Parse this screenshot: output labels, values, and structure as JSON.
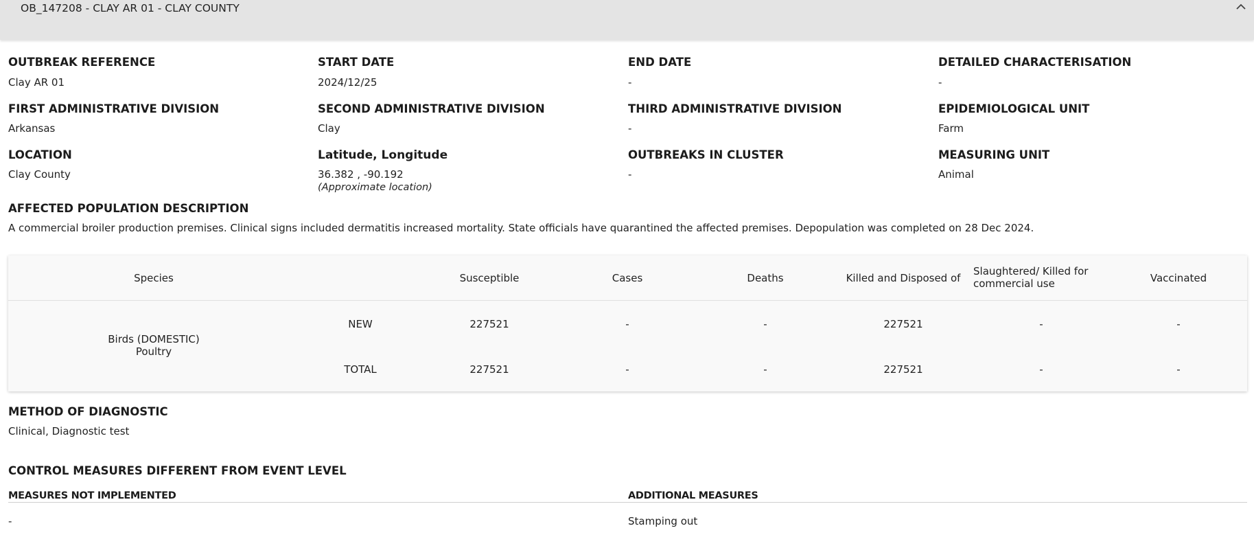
{
  "header": {
    "title": "OB_147208 - CLAY AR 01 - CLAY COUNTY"
  },
  "fields": {
    "outbreak_reference": {
      "label": "OUTBREAK REFERENCE",
      "value": "Clay AR 01"
    },
    "start_date": {
      "label": "START DATE",
      "value": "2024/12/25"
    },
    "end_date": {
      "label": "END DATE",
      "value": "-"
    },
    "detailed_characterisation": {
      "label": "DETAILED CHARACTERISATION",
      "value": "-"
    },
    "first_admin_division": {
      "label": "FIRST ADMINISTRATIVE DIVISION",
      "value": "Arkansas"
    },
    "second_admin_division": {
      "label": "SECOND ADMINISTRATIVE DIVISION",
      "value": "Clay"
    },
    "third_admin_division": {
      "label": "THIRD ADMINISTRATIVE DIVISION",
      "value": "-"
    },
    "epidemiological_unit": {
      "label": "EPIDEMIOLOGICAL UNIT",
      "value": "Farm"
    },
    "location": {
      "label": "LOCATION",
      "value": "Clay County"
    },
    "lat_long": {
      "label": "Latitude, Longitude",
      "value": "36.382 , -90.192",
      "note": "(Approximate location)"
    },
    "outbreaks_in_cluster": {
      "label": "OUTBREAKS IN CLUSTER",
      "value": "-"
    },
    "measuring_unit": {
      "label": "MEASURING UNIT",
      "value": "Animal"
    }
  },
  "affected_population": {
    "label": "AFFECTED POPULATION DESCRIPTION",
    "text": "A commercial broiler production premises. Clinical signs included dermatitis increased mortality. State officials have quarantined the affected premises. Depopulation was completed on 28 Dec 2024."
  },
  "table": {
    "headers": {
      "species": "Species",
      "susceptible": "Susceptible",
      "cases": "Cases",
      "deaths": "Deaths",
      "killed": "Killed and Disposed of",
      "slaughtered_1": "Slaughtered/ Killed for",
      "slaughtered_2": "commercial use",
      "vaccinated": "Vaccinated"
    },
    "species_line1": "Birds (DOMESTIC)",
    "species_line2": "Poultry",
    "rows": [
      {
        "type": "NEW",
        "susceptible": "227521",
        "cases": "-",
        "deaths": "-",
        "killed": "227521",
        "slaughtered": "-",
        "vaccinated": "-"
      },
      {
        "type": "TOTAL",
        "susceptible": "227521",
        "cases": "-",
        "deaths": "-",
        "killed": "227521",
        "slaughtered": "-",
        "vaccinated": "-"
      }
    ]
  },
  "method_of_diagnostic": {
    "label": "METHOD OF DIAGNOSTIC",
    "value": "Clinical, Diagnostic test"
  },
  "control_measures": {
    "label": "CONTROL MEASURES DIFFERENT FROM EVENT LEVEL",
    "not_implemented_label": "MEASURES NOT IMPLEMENTED",
    "not_implemented_value": "-",
    "additional_label": "ADDITIONAL MEASURES",
    "additional_value": "Stamping out"
  },
  "icons": {
    "collapse": "chevron-up-icon"
  }
}
